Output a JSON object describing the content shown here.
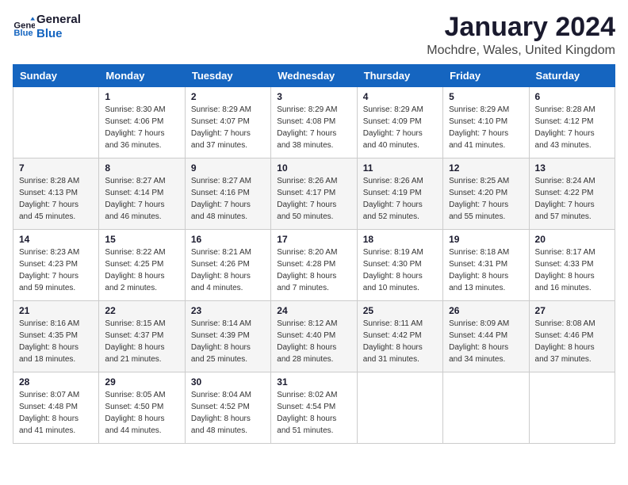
{
  "logo": {
    "line1": "General",
    "line2": "Blue"
  },
  "calendar": {
    "title": "January 2024",
    "subtitle": "Mochdre, Wales, United Kingdom"
  },
  "weekdays": [
    "Sunday",
    "Monday",
    "Tuesday",
    "Wednesday",
    "Thursday",
    "Friday",
    "Saturday"
  ],
  "weeks": [
    [
      {
        "day": "",
        "sunrise": "",
        "sunset": "",
        "daylight": ""
      },
      {
        "day": "1",
        "sunrise": "Sunrise: 8:30 AM",
        "sunset": "Sunset: 4:06 PM",
        "daylight": "Daylight: 7 hours and 36 minutes."
      },
      {
        "day": "2",
        "sunrise": "Sunrise: 8:29 AM",
        "sunset": "Sunset: 4:07 PM",
        "daylight": "Daylight: 7 hours and 37 minutes."
      },
      {
        "day": "3",
        "sunrise": "Sunrise: 8:29 AM",
        "sunset": "Sunset: 4:08 PM",
        "daylight": "Daylight: 7 hours and 38 minutes."
      },
      {
        "day": "4",
        "sunrise": "Sunrise: 8:29 AM",
        "sunset": "Sunset: 4:09 PM",
        "daylight": "Daylight: 7 hours and 40 minutes."
      },
      {
        "day": "5",
        "sunrise": "Sunrise: 8:29 AM",
        "sunset": "Sunset: 4:10 PM",
        "daylight": "Daylight: 7 hours and 41 minutes."
      },
      {
        "day": "6",
        "sunrise": "Sunrise: 8:28 AM",
        "sunset": "Sunset: 4:12 PM",
        "daylight": "Daylight: 7 hours and 43 minutes."
      }
    ],
    [
      {
        "day": "7",
        "sunrise": "Sunrise: 8:28 AM",
        "sunset": "Sunset: 4:13 PM",
        "daylight": "Daylight: 7 hours and 45 minutes."
      },
      {
        "day": "8",
        "sunrise": "Sunrise: 8:27 AM",
        "sunset": "Sunset: 4:14 PM",
        "daylight": "Daylight: 7 hours and 46 minutes."
      },
      {
        "day": "9",
        "sunrise": "Sunrise: 8:27 AM",
        "sunset": "Sunset: 4:16 PM",
        "daylight": "Daylight: 7 hours and 48 minutes."
      },
      {
        "day": "10",
        "sunrise": "Sunrise: 8:26 AM",
        "sunset": "Sunset: 4:17 PM",
        "daylight": "Daylight: 7 hours and 50 minutes."
      },
      {
        "day": "11",
        "sunrise": "Sunrise: 8:26 AM",
        "sunset": "Sunset: 4:19 PM",
        "daylight": "Daylight: 7 hours and 52 minutes."
      },
      {
        "day": "12",
        "sunrise": "Sunrise: 8:25 AM",
        "sunset": "Sunset: 4:20 PM",
        "daylight": "Daylight: 7 hours and 55 minutes."
      },
      {
        "day": "13",
        "sunrise": "Sunrise: 8:24 AM",
        "sunset": "Sunset: 4:22 PM",
        "daylight": "Daylight: 7 hours and 57 minutes."
      }
    ],
    [
      {
        "day": "14",
        "sunrise": "Sunrise: 8:23 AM",
        "sunset": "Sunset: 4:23 PM",
        "daylight": "Daylight: 7 hours and 59 minutes."
      },
      {
        "day": "15",
        "sunrise": "Sunrise: 8:22 AM",
        "sunset": "Sunset: 4:25 PM",
        "daylight": "Daylight: 8 hours and 2 minutes."
      },
      {
        "day": "16",
        "sunrise": "Sunrise: 8:21 AM",
        "sunset": "Sunset: 4:26 PM",
        "daylight": "Daylight: 8 hours and 4 minutes."
      },
      {
        "day": "17",
        "sunrise": "Sunrise: 8:20 AM",
        "sunset": "Sunset: 4:28 PM",
        "daylight": "Daylight: 8 hours and 7 minutes."
      },
      {
        "day": "18",
        "sunrise": "Sunrise: 8:19 AM",
        "sunset": "Sunset: 4:30 PM",
        "daylight": "Daylight: 8 hours and 10 minutes."
      },
      {
        "day": "19",
        "sunrise": "Sunrise: 8:18 AM",
        "sunset": "Sunset: 4:31 PM",
        "daylight": "Daylight: 8 hours and 13 minutes."
      },
      {
        "day": "20",
        "sunrise": "Sunrise: 8:17 AM",
        "sunset": "Sunset: 4:33 PM",
        "daylight": "Daylight: 8 hours and 16 minutes."
      }
    ],
    [
      {
        "day": "21",
        "sunrise": "Sunrise: 8:16 AM",
        "sunset": "Sunset: 4:35 PM",
        "daylight": "Daylight: 8 hours and 18 minutes."
      },
      {
        "day": "22",
        "sunrise": "Sunrise: 8:15 AM",
        "sunset": "Sunset: 4:37 PM",
        "daylight": "Daylight: 8 hours and 21 minutes."
      },
      {
        "day": "23",
        "sunrise": "Sunrise: 8:14 AM",
        "sunset": "Sunset: 4:39 PM",
        "daylight": "Daylight: 8 hours and 25 minutes."
      },
      {
        "day": "24",
        "sunrise": "Sunrise: 8:12 AM",
        "sunset": "Sunset: 4:40 PM",
        "daylight": "Daylight: 8 hours and 28 minutes."
      },
      {
        "day": "25",
        "sunrise": "Sunrise: 8:11 AM",
        "sunset": "Sunset: 4:42 PM",
        "daylight": "Daylight: 8 hours and 31 minutes."
      },
      {
        "day": "26",
        "sunrise": "Sunrise: 8:09 AM",
        "sunset": "Sunset: 4:44 PM",
        "daylight": "Daylight: 8 hours and 34 minutes."
      },
      {
        "day": "27",
        "sunrise": "Sunrise: 8:08 AM",
        "sunset": "Sunset: 4:46 PM",
        "daylight": "Daylight: 8 hours and 37 minutes."
      }
    ],
    [
      {
        "day": "28",
        "sunrise": "Sunrise: 8:07 AM",
        "sunset": "Sunset: 4:48 PM",
        "daylight": "Daylight: 8 hours and 41 minutes."
      },
      {
        "day": "29",
        "sunrise": "Sunrise: 8:05 AM",
        "sunset": "Sunset: 4:50 PM",
        "daylight": "Daylight: 8 hours and 44 minutes."
      },
      {
        "day": "30",
        "sunrise": "Sunrise: 8:04 AM",
        "sunset": "Sunset: 4:52 PM",
        "daylight": "Daylight: 8 hours and 48 minutes."
      },
      {
        "day": "31",
        "sunrise": "Sunrise: 8:02 AM",
        "sunset": "Sunset: 4:54 PM",
        "daylight": "Daylight: 8 hours and 51 minutes."
      },
      {
        "day": "",
        "sunrise": "",
        "sunset": "",
        "daylight": ""
      },
      {
        "day": "",
        "sunrise": "",
        "sunset": "",
        "daylight": ""
      },
      {
        "day": "",
        "sunrise": "",
        "sunset": "",
        "daylight": ""
      }
    ]
  ]
}
